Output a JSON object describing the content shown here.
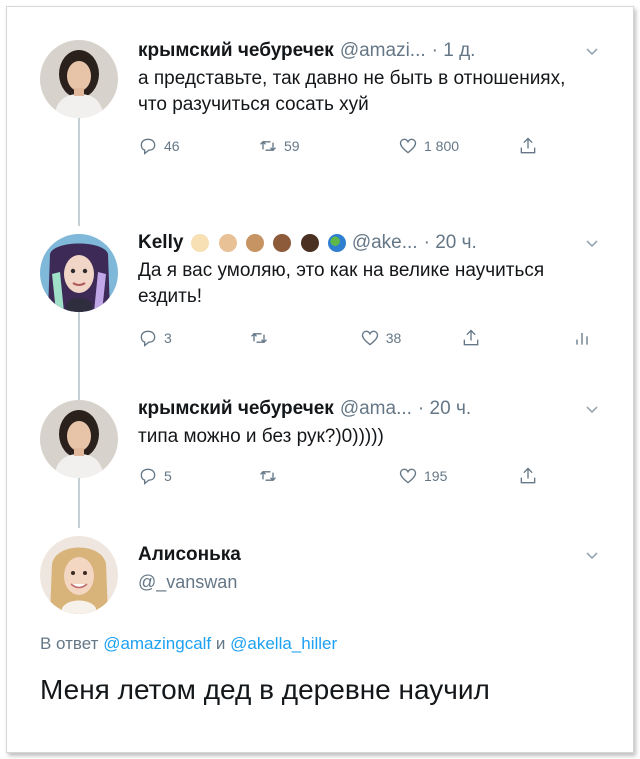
{
  "tweets": [
    {
      "name": "крымский чебуречек",
      "handle": "@amazi...",
      "time": "· 1 д.",
      "text": "а представьте, так давно не быть в отношениях, что разучиться сосать хуй",
      "replies": "46",
      "retweets": "59",
      "likes": "1 800"
    },
    {
      "name": "Kelly",
      "handle": "@ake...",
      "time": "· 20 ч.",
      "text": "Да я вас умоляю, это как на велике научиться ездить!",
      "replies": "3",
      "retweets": "",
      "likes": "38"
    },
    {
      "name": "крымский чебуречек",
      "handle": "@ama...",
      "time": "· 20 ч.",
      "text": "типа можно и без рук?)0)))))",
      "replies": "5",
      "retweets": "",
      "likes": "195"
    }
  ],
  "last_tweet": {
    "name": "Алисонька",
    "handle": "@_vanswan",
    "replying_prefix": "В ответ",
    "replying_user1": "@amazingcalf",
    "replying_and": "и",
    "replying_user2": "@akella_hiller",
    "text": "Меня летом дед в деревне научил"
  },
  "icons": [
    "reply-icon",
    "retweet-icon",
    "like-icon",
    "share-icon",
    "analytics-icon",
    "chevron-down-icon"
  ],
  "colors": {
    "accent": "#1da1f2",
    "muted": "#657786",
    "thread": "#c4cfd6",
    "text": "#14171a"
  }
}
